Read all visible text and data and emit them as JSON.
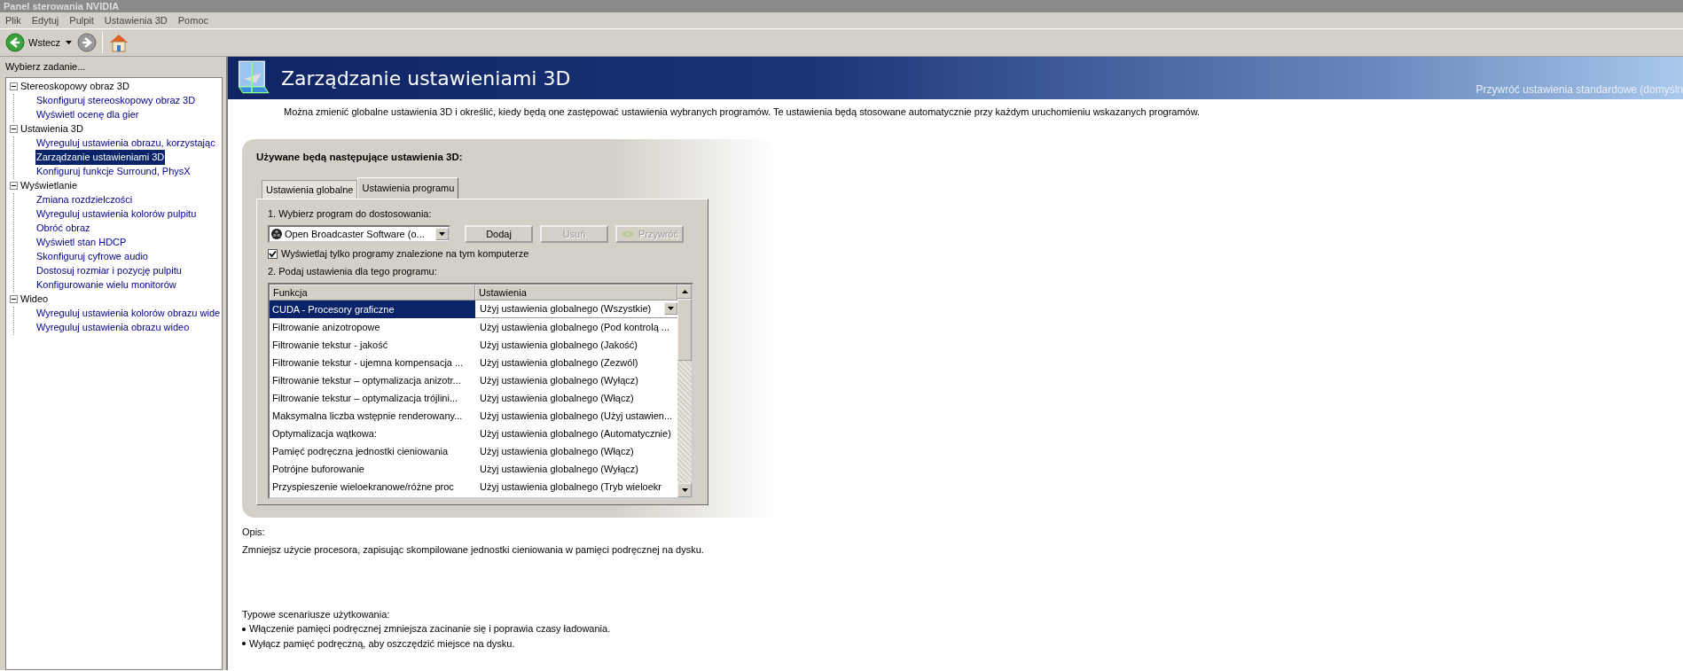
{
  "window": {
    "title": "Panel sterowania NVIDIA"
  },
  "menu": [
    "Plik",
    "Edytuj",
    "Pulpit",
    "Ustawienia 3D",
    "Pomoc"
  ],
  "toolbar": {
    "back_label": "Wstecz"
  },
  "sidebar": {
    "title": "Wybierz zadanie...",
    "items": [
      {
        "label": "Stereoskopowy obraz 3D",
        "expanded": true,
        "children": [
          {
            "label": "Skonfiguruj stereoskopowy obraz 3D",
            "selected": false
          },
          {
            "label": "Wyświetl ocenę dla gier",
            "selected": false
          }
        ]
      },
      {
        "label": "Ustawienia 3D",
        "expanded": true,
        "children": [
          {
            "label": "Wyreguluj ustawienia obrazu, korzystając",
            "selected": false
          },
          {
            "label": "Zarządzanie ustawieniami 3D",
            "selected": true
          },
          {
            "label": "Konfiguruj funkcje Surround, PhysX",
            "selected": false
          }
        ]
      },
      {
        "label": "Wyświetlanie",
        "expanded": true,
        "children": [
          {
            "label": "Zmiana rozdzielczości",
            "selected": false
          },
          {
            "label": "Wyreguluj ustawienia kolorów pulpitu",
            "selected": false
          },
          {
            "label": "Obróć obraz",
            "selected": false
          },
          {
            "label": "Wyświetl stan HDCP",
            "selected": false
          },
          {
            "label": "Skonfiguruj cyfrowe audio",
            "selected": false
          },
          {
            "label": "Dostosuj rozmiar i pozycję pulpitu",
            "selected": false
          },
          {
            "label": "Konfigurowanie wielu monitorów",
            "selected": false
          }
        ]
      },
      {
        "label": "Wideo",
        "expanded": true,
        "children": [
          {
            "label": "Wyreguluj ustawienia kolorów obrazu wide",
            "selected": false
          },
          {
            "label": "Wyreguluj ustawienia obrazu wideo",
            "selected": false
          }
        ]
      }
    ]
  },
  "header": {
    "title": "Zarządzanie ustawieniami 3D",
    "restore_link": "Przywróć ustawienia standardowe (domyśln"
  },
  "intro": "Można zmienić globalne ustawienia 3D i określić, kiedy będą one zastępować ustawienia wybranych programów. Te ustawienia będą stosowane automatycznie przy każdym uruchomieniu wskazanych programów.",
  "settings_panel": {
    "title": "Używane będą następujące ustawienia 3D:",
    "tabs": [
      {
        "label": "Ustawienia globalne",
        "selected": false
      },
      {
        "label": "Ustawienia programu",
        "selected": true
      }
    ],
    "step1": "1. Wybierz program do dostosowania:",
    "program": "Open Broadcaster Software (o...",
    "buttons": [
      {
        "label": "Dodaj",
        "disabled": false,
        "kind": "plain"
      },
      {
        "label": "Usuń",
        "disabled": true,
        "kind": "plain"
      },
      {
        "label": "Przywróć",
        "disabled": true,
        "kind": "nvidia"
      }
    ],
    "only_installed": {
      "label": "Wyświetlaj tylko programy znalezione na tym komputerze",
      "checked": true
    },
    "step2": "2. Podaj ustawienia dla tego programu:",
    "table": {
      "columns": [
        "Funkcja",
        "Ustawienia"
      ],
      "rows": [
        {
          "feature": "CUDA - Procesory graficzne",
          "setting": "Użyj ustawienia globalnego (Wszystkie)",
          "selected": true
        },
        {
          "feature": "Filtrowanie anizotropowe",
          "setting": "Użyj ustawienia globalnego (Pod kontrolą ...",
          "selected": false
        },
        {
          "feature": "Filtrowanie tekstur - jakość",
          "setting": "Użyj ustawienia globalnego (Jakość)",
          "selected": false
        },
        {
          "feature": "Filtrowanie tekstur - ujemna kompensacja ...",
          "setting": "Użyj ustawienia globalnego (Zezwól)",
          "selected": false
        },
        {
          "feature": "Filtrowanie tekstur – optymalizacja anizotr...",
          "setting": "Użyj ustawienia globalnego (Wyłącz)",
          "selected": false
        },
        {
          "feature": "Filtrowanie tekstur – optymalizacja trójlini...",
          "setting": "Użyj ustawienia globalnego (Włącz)",
          "selected": false
        },
        {
          "feature": "Maksymalna liczba wstępnie renderowany...",
          "setting": "Użyj ustawienia globalnego (Użyj ustawien...",
          "selected": false
        },
        {
          "feature": "Optymalizacja wątkowa:",
          "setting": "Użyj ustawienia globalnego (Automatycznie)",
          "selected": false
        },
        {
          "feature": "Pamięć podręczna jednostki cieniowania",
          "setting": "Użyj ustawienia globalnego (Włącz)",
          "selected": false
        },
        {
          "feature": "Potrójne buforowanie",
          "setting": "Użyj ustawienia globalnego (Wyłącz)",
          "selected": false
        },
        {
          "feature": "Przyspieszenie wieloekranowe/różne proc",
          "setting": "Użyj ustawienia globalnego (Tryb wieloekr",
          "selected": false
        }
      ]
    }
  },
  "description": {
    "label": "Opis:",
    "text": "Zmniejsz użycie procesora, zapisując skompilowane jednostki cieniowania w pamięci podręcznej na dysku."
  },
  "usage": {
    "label": "Typowe scenariusze użytkowania:",
    "items": [
      "Włączenie pamięci podręcznej zmniejsza zacinanie się i poprawia czasy ładowania.",
      "Wyłącz pamięć podręczną, aby oszczędzić miejsce na dysku."
    ]
  }
}
